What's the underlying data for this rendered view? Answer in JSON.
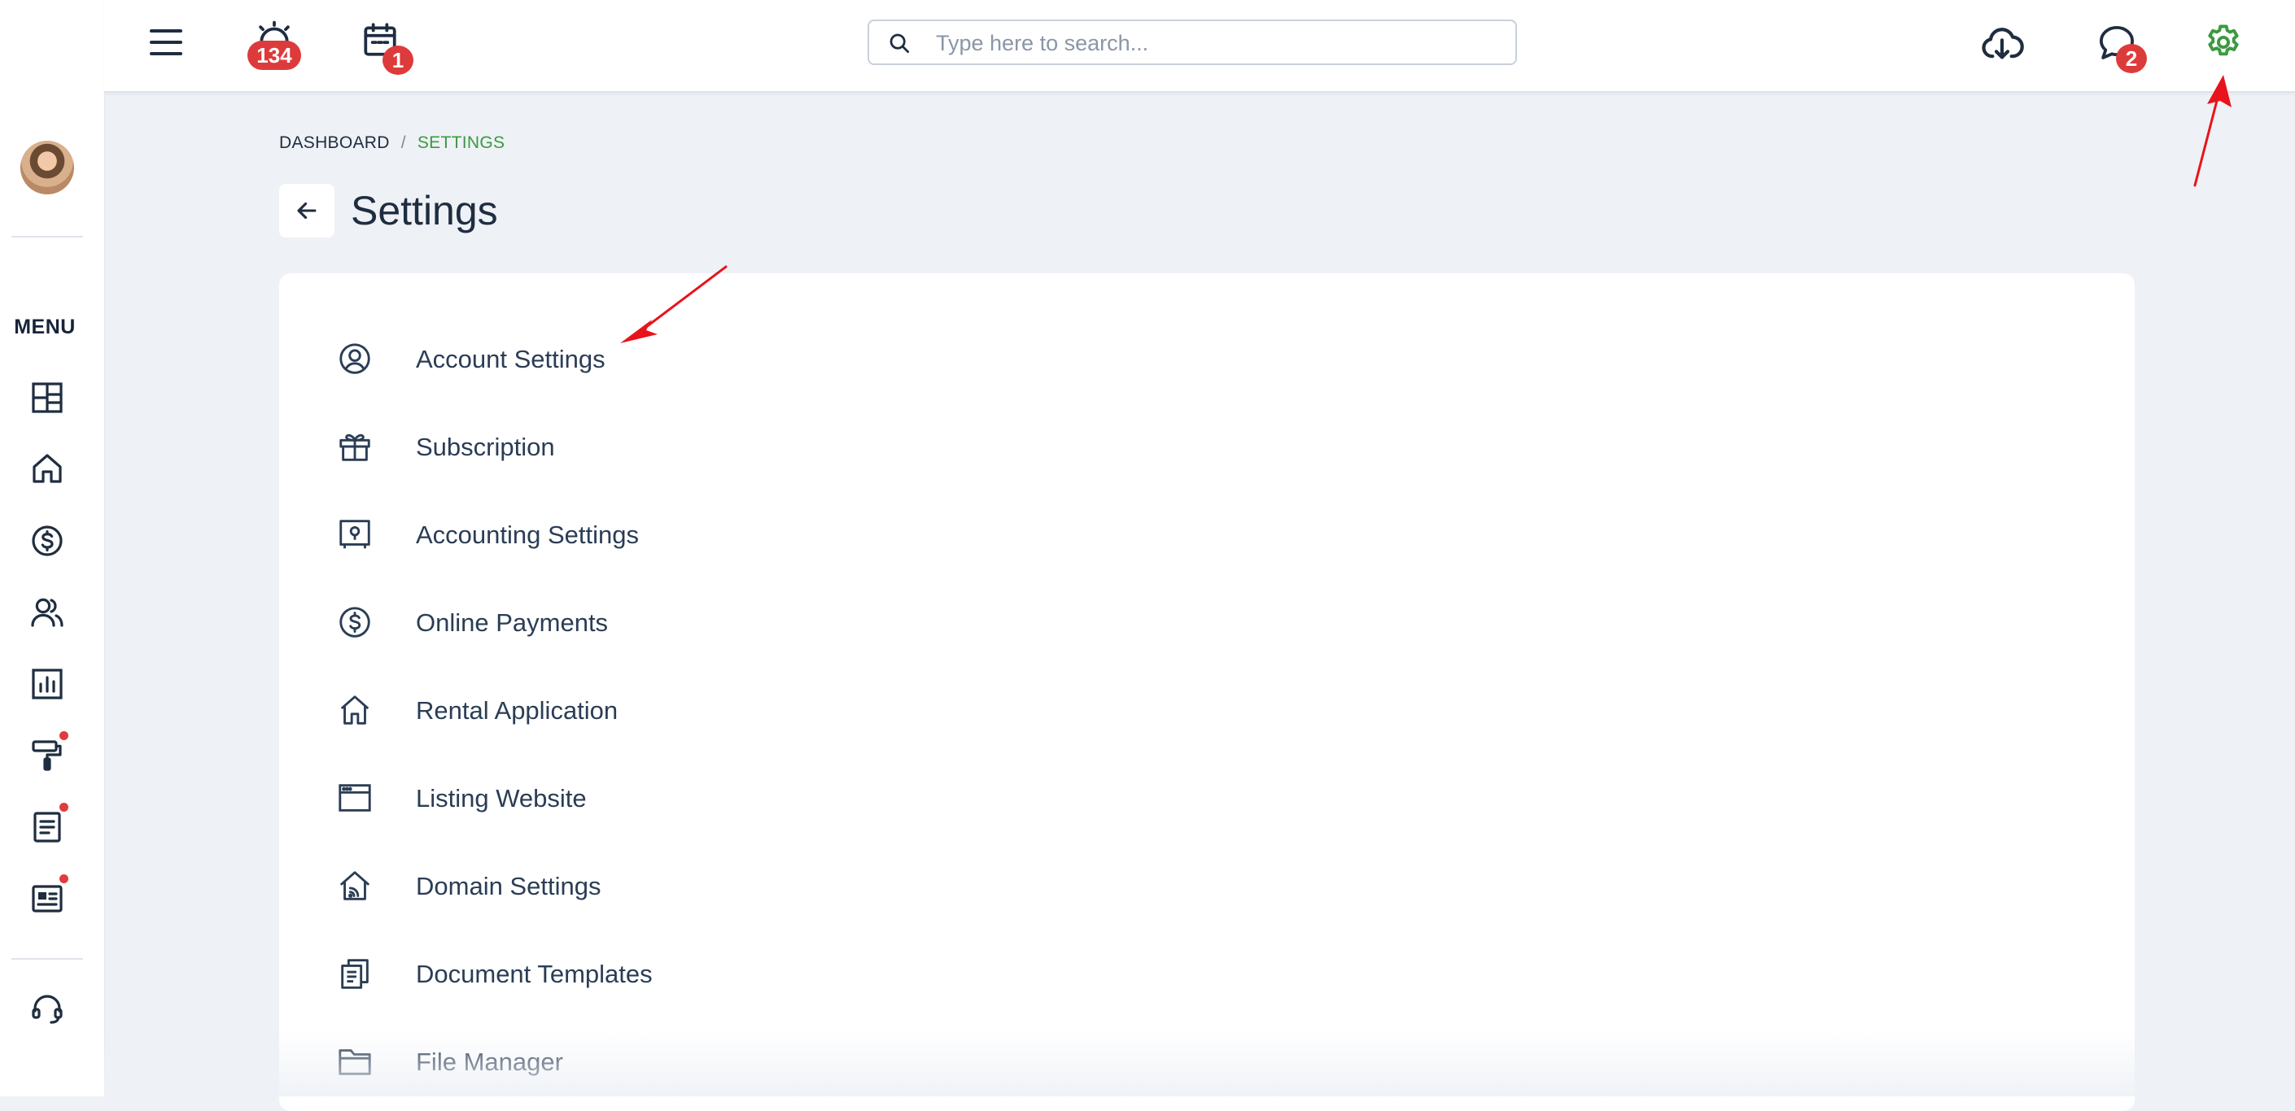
{
  "topbar": {
    "search_placeholder": "Type here to search...",
    "alarm_badge": "134",
    "calendar_badge": "1",
    "messages_badge": "2"
  },
  "sidebar": {
    "menu_label": "MENU"
  },
  "breadcrumb": {
    "items": [
      "DASHBOARD",
      "SETTINGS"
    ],
    "separator": "/"
  },
  "page": {
    "title": "Settings"
  },
  "settings_items": [
    {
      "label": "Account Settings",
      "icon": "user-circle-icon"
    },
    {
      "label": "Subscription",
      "icon": "gift-icon"
    },
    {
      "label": "Accounting Settings",
      "icon": "safe-icon"
    },
    {
      "label": "Online Payments",
      "icon": "dollar-circle-icon"
    },
    {
      "label": "Rental Application",
      "icon": "house-icon"
    },
    {
      "label": "Listing Website",
      "icon": "browser-window-icon"
    },
    {
      "label": "Domain Settings",
      "icon": "house-signal-icon"
    },
    {
      "label": "Document Templates",
      "icon": "documents-icon"
    },
    {
      "label": "File Manager",
      "icon": "folder-icon"
    }
  ],
  "colors": {
    "accent_green": "#3a9a3e",
    "badge_red": "#dd3b3b",
    "annotation_red": "#e8141b",
    "text_dark": "#1f2d40"
  }
}
